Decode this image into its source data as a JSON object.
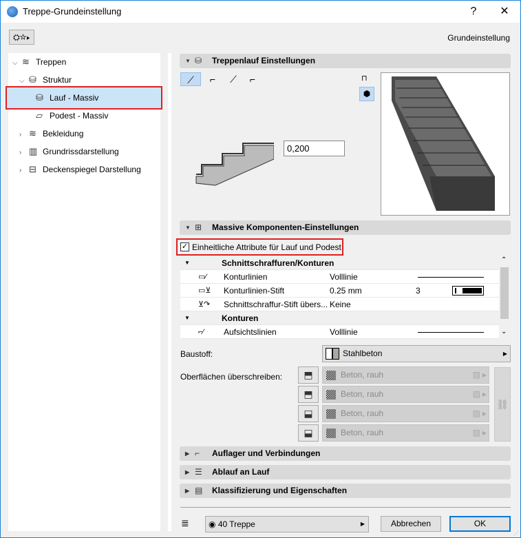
{
  "window": {
    "title": "Treppe-Grundeinstellung",
    "help": "?",
    "close": "✕"
  },
  "header": {
    "preset_label": "Grundeinstellung"
  },
  "tree": {
    "items": [
      {
        "label": "Treppen",
        "icon": "stairs-icon"
      },
      {
        "label": "Struktur",
        "icon": "structure-icon"
      },
      {
        "label": "Lauf - Massiv",
        "icon": "flight-icon"
      },
      {
        "label": "Podest - Massiv",
        "icon": "landing-icon"
      },
      {
        "label": "Bekleidung",
        "icon": "finish-icon"
      },
      {
        "label": "Grundrissdarstellung",
        "icon": "floorplan-icon"
      },
      {
        "label": "Deckenspiegel Darstellung",
        "icon": "ceiling-icon"
      }
    ]
  },
  "sections": {
    "flight": "Treppenlauf Einstellungen",
    "components": "Massive Komponenten-Einstellungen",
    "supports": "Auflager und Verbindungen",
    "drainage": "Ablauf an Lauf",
    "classification": "Klassifizierung und Eigenschaften"
  },
  "flight": {
    "thickness_value": "0,200"
  },
  "components": {
    "uniform_attributes_label": "Einheitliche Attribute für Lauf und Podest",
    "uniform_attributes_checked": true,
    "table": [
      {
        "group": "Schnittschraffuren/Konturen"
      },
      {
        "name": "Konturlinien",
        "value": "Volllinie",
        "extra": "",
        "line": true
      },
      {
        "name": "Konturlinien-Stift",
        "value": "0.25 mm",
        "extra": "3",
        "pen": true
      },
      {
        "name": "Schnittschraffur-Stift übers...",
        "value": "Keine",
        "extra": ""
      },
      {
        "group": "Konturen"
      },
      {
        "name": "Aufsichtslinien",
        "value": "Volllinie",
        "extra": "",
        "line": true
      }
    ],
    "material_label": "Baustoff:",
    "material_value": "Stahlbeton",
    "surfaces_label": "Oberflächen überschreiben:",
    "surfaces": [
      "Beton, rauh",
      "Beton, rauh",
      "Beton, rauh",
      "Beton, rauh"
    ]
  },
  "footer": {
    "layer": "40 Treppe",
    "cancel": "Abbrechen",
    "ok": "OK"
  },
  "colors": {
    "accent": "#1883d7",
    "selection": "#cce4f7",
    "highlight": "#e02020"
  }
}
